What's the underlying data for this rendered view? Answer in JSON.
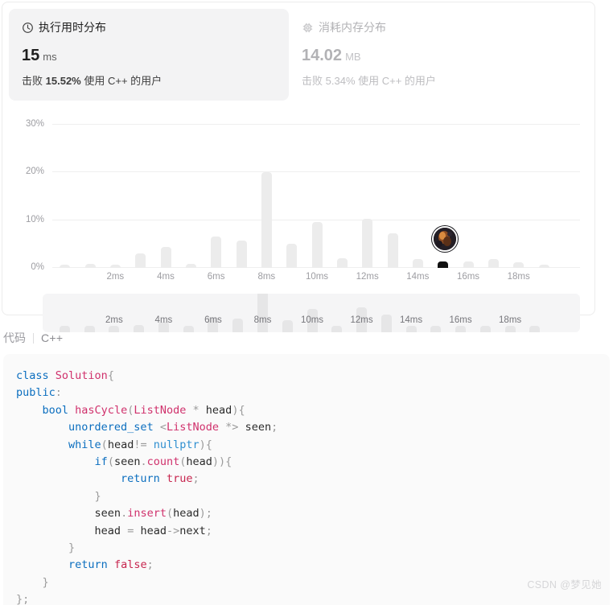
{
  "stats": {
    "runtime_card": {
      "icon": "clock-icon",
      "title": "执行用时分布",
      "value": "15",
      "unit": "ms",
      "beat_prefix": "击败",
      "beat_percent": "15.52%",
      "beat_suffix": "使用 C++ 的用户"
    },
    "memory_card": {
      "icon": "chip-icon",
      "title": "消耗内存分布",
      "value": "14.02",
      "unit": "MB",
      "beat_prefix": "击败",
      "beat_percent": "5.34%",
      "beat_suffix": "使用 C++ 的用户"
    }
  },
  "chart_data": {
    "type": "bar",
    "title": "执行用时分布",
    "xlabel": "",
    "ylabel": "",
    "ylim": [
      0,
      32
    ],
    "grid": true,
    "legend": "none",
    "ytick_labels": [
      "0%",
      "10%",
      "20%",
      "30%"
    ],
    "ytick_values": [
      0,
      10,
      20,
      30
    ],
    "xtick_labels": [
      "2ms",
      "4ms",
      "6ms",
      "8ms",
      "10ms",
      "12ms",
      "14ms",
      "16ms",
      "18ms"
    ],
    "xtick_values": [
      2,
      4,
      6,
      8,
      10,
      12,
      14,
      16,
      18
    ],
    "x": [
      0,
      1,
      2,
      3,
      4,
      5,
      6,
      7,
      8,
      9,
      10,
      11,
      12,
      13,
      14,
      15,
      16,
      17,
      18,
      19
    ],
    "values": [
      0.7,
      0.8,
      0.7,
      3.1,
      4.3,
      0.9,
      6.5,
      5.8,
      20.0,
      5.0,
      9.6,
      2.1,
      10.3,
      7.3,
      1.9,
      1.4,
      1.4,
      1.9,
      1.1,
      0.7
    ],
    "highlight_index": 15,
    "highlight_label": "15ms",
    "highlight_color": "#111111",
    "bar_color": "#ececec",
    "minimap": {
      "visible": true,
      "bar_color": "#e6e6e7",
      "xtick_labels": [
        "2ms",
        "4ms",
        "6ms",
        "8ms",
        "10ms",
        "12ms",
        "14ms",
        "16ms",
        "18ms"
      ],
      "values": [
        0.7,
        0.8,
        0.7,
        3.1,
        4.3,
        0.9,
        6.5,
        5.8,
        20.0,
        5.0,
        9.6,
        2.1,
        10.3,
        7.3,
        1.9,
        1.4,
        1.4,
        1.9,
        1.1,
        0.7
      ]
    }
  },
  "code_section": {
    "label": "代码",
    "language": "C++",
    "lines": [
      "class Solution{",
      "public:",
      "    bool hasCycle(ListNode * head){",
      "        unordered_set <ListNode *> seen;",
      "        while(head!= nullptr){",
      "            if(seen.count(head)){",
      "                return true;",
      "            }",
      "            seen.insert(head);",
      "            head = head->next;",
      "        }",
      "        return false;",
      "    }",
      "};"
    ]
  },
  "watermark": {
    "text": "CSDN @梦见她"
  }
}
